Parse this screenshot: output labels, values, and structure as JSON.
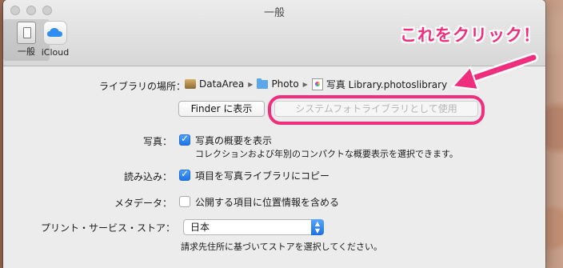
{
  "window": {
    "title": "一般",
    "toolbar": [
      {
        "label": "一般",
        "icon": "general-icon"
      },
      {
        "label": "iCloud",
        "icon": "icloud-icon"
      }
    ]
  },
  "annotation": {
    "text": "これをクリック！",
    "color": "#ef2f7e"
  },
  "library": {
    "label": "ライブラリの場所：",
    "path": [
      "DataArea",
      "Photo",
      "写真 Library.photoslibrary"
    ],
    "finder_button": "Finder に表示",
    "system_library_button": "システムフォトライブラリとして使用"
  },
  "photos": {
    "label": "写真：",
    "checkbox_label": "写真の概要を表示",
    "checked": true,
    "description": "コレクションおよび年別のコンパクトな概要表示を選択できます。"
  },
  "import": {
    "label": "読み込み：",
    "checkbox_label": "項目を写真ライブラリにコピー",
    "checked": true
  },
  "metadata": {
    "label": "メタデータ：",
    "checkbox_label": "公開する項目に位置情報を含める",
    "checked": false
  },
  "print_store": {
    "label": "プリント・サービス・ストア：",
    "selected": "日本",
    "description": "請求先住所に基づいてストアを選択してください。"
  },
  "colors": {
    "accent": "#1d74e6",
    "highlight": "#ef2f7e"
  }
}
